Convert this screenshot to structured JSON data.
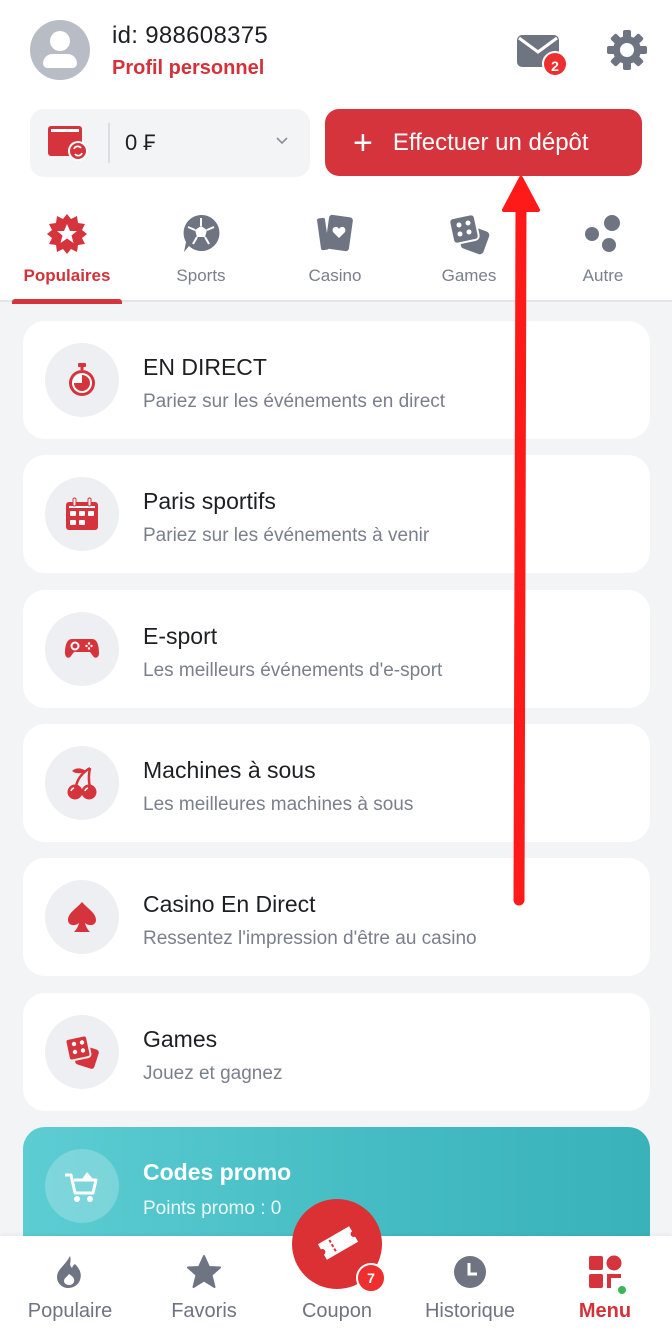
{
  "header": {
    "user_id": "id: 988608375",
    "profile_link": "Profil personnel",
    "mail_badge": "2"
  },
  "balance": {
    "value": "0 ₣",
    "icon": "wallet-refresh-icon"
  },
  "deposit_button": {
    "plus": "+",
    "label": "Effectuer un dépôt"
  },
  "tabs": [
    {
      "label": "Populaires",
      "icon": "star-badge-icon",
      "active": true
    },
    {
      "label": "Sports",
      "icon": "soccer-ball-icon",
      "active": false
    },
    {
      "label": "Casino",
      "icon": "cards-icon",
      "active": false
    },
    {
      "label": "Games",
      "icon": "dice-icon",
      "active": false
    },
    {
      "label": "Autre",
      "icon": "circles-icon",
      "active": false
    }
  ],
  "menu_items": [
    {
      "title": "EN DIRECT",
      "subtitle": "Pariez sur les événements en direct",
      "icon": "stopwatch-icon"
    },
    {
      "title": "Paris sportifs",
      "subtitle": "Pariez sur les événements à venir",
      "icon": "calendar-icon"
    },
    {
      "title": "E-sport",
      "subtitle": "Les meilleurs événements d'e-sport",
      "icon": "gamepad-icon"
    },
    {
      "title": "Machines à sous",
      "subtitle": "Les meilleures machines à sous",
      "icon": "cherries-icon"
    },
    {
      "title": "Casino En Direct",
      "subtitle": "Ressentez l'impression d'être au casino",
      "icon": "spade-icon"
    },
    {
      "title": "Games",
      "subtitle": "Jouez et gagnez",
      "icon": "dice-icon"
    }
  ],
  "promo": {
    "title": "Codes promo",
    "subtitle": "Points promo : 0"
  },
  "bottom_nav": [
    {
      "label": "Populaire",
      "icon": "flame-icon"
    },
    {
      "label": "Favoris",
      "icon": "star-icon"
    },
    {
      "label": "Coupon",
      "icon": "ticket-icon",
      "badge": "7"
    },
    {
      "label": "Historique",
      "icon": "clock-icon"
    },
    {
      "label": "Menu",
      "icon": "menu-grid-icon",
      "active": true
    }
  ],
  "colors": {
    "accent": "#d6343d",
    "promo": "#45bcc3",
    "icon_gray": "#6f7482",
    "annotation_arrow": "#ff1a1a"
  }
}
